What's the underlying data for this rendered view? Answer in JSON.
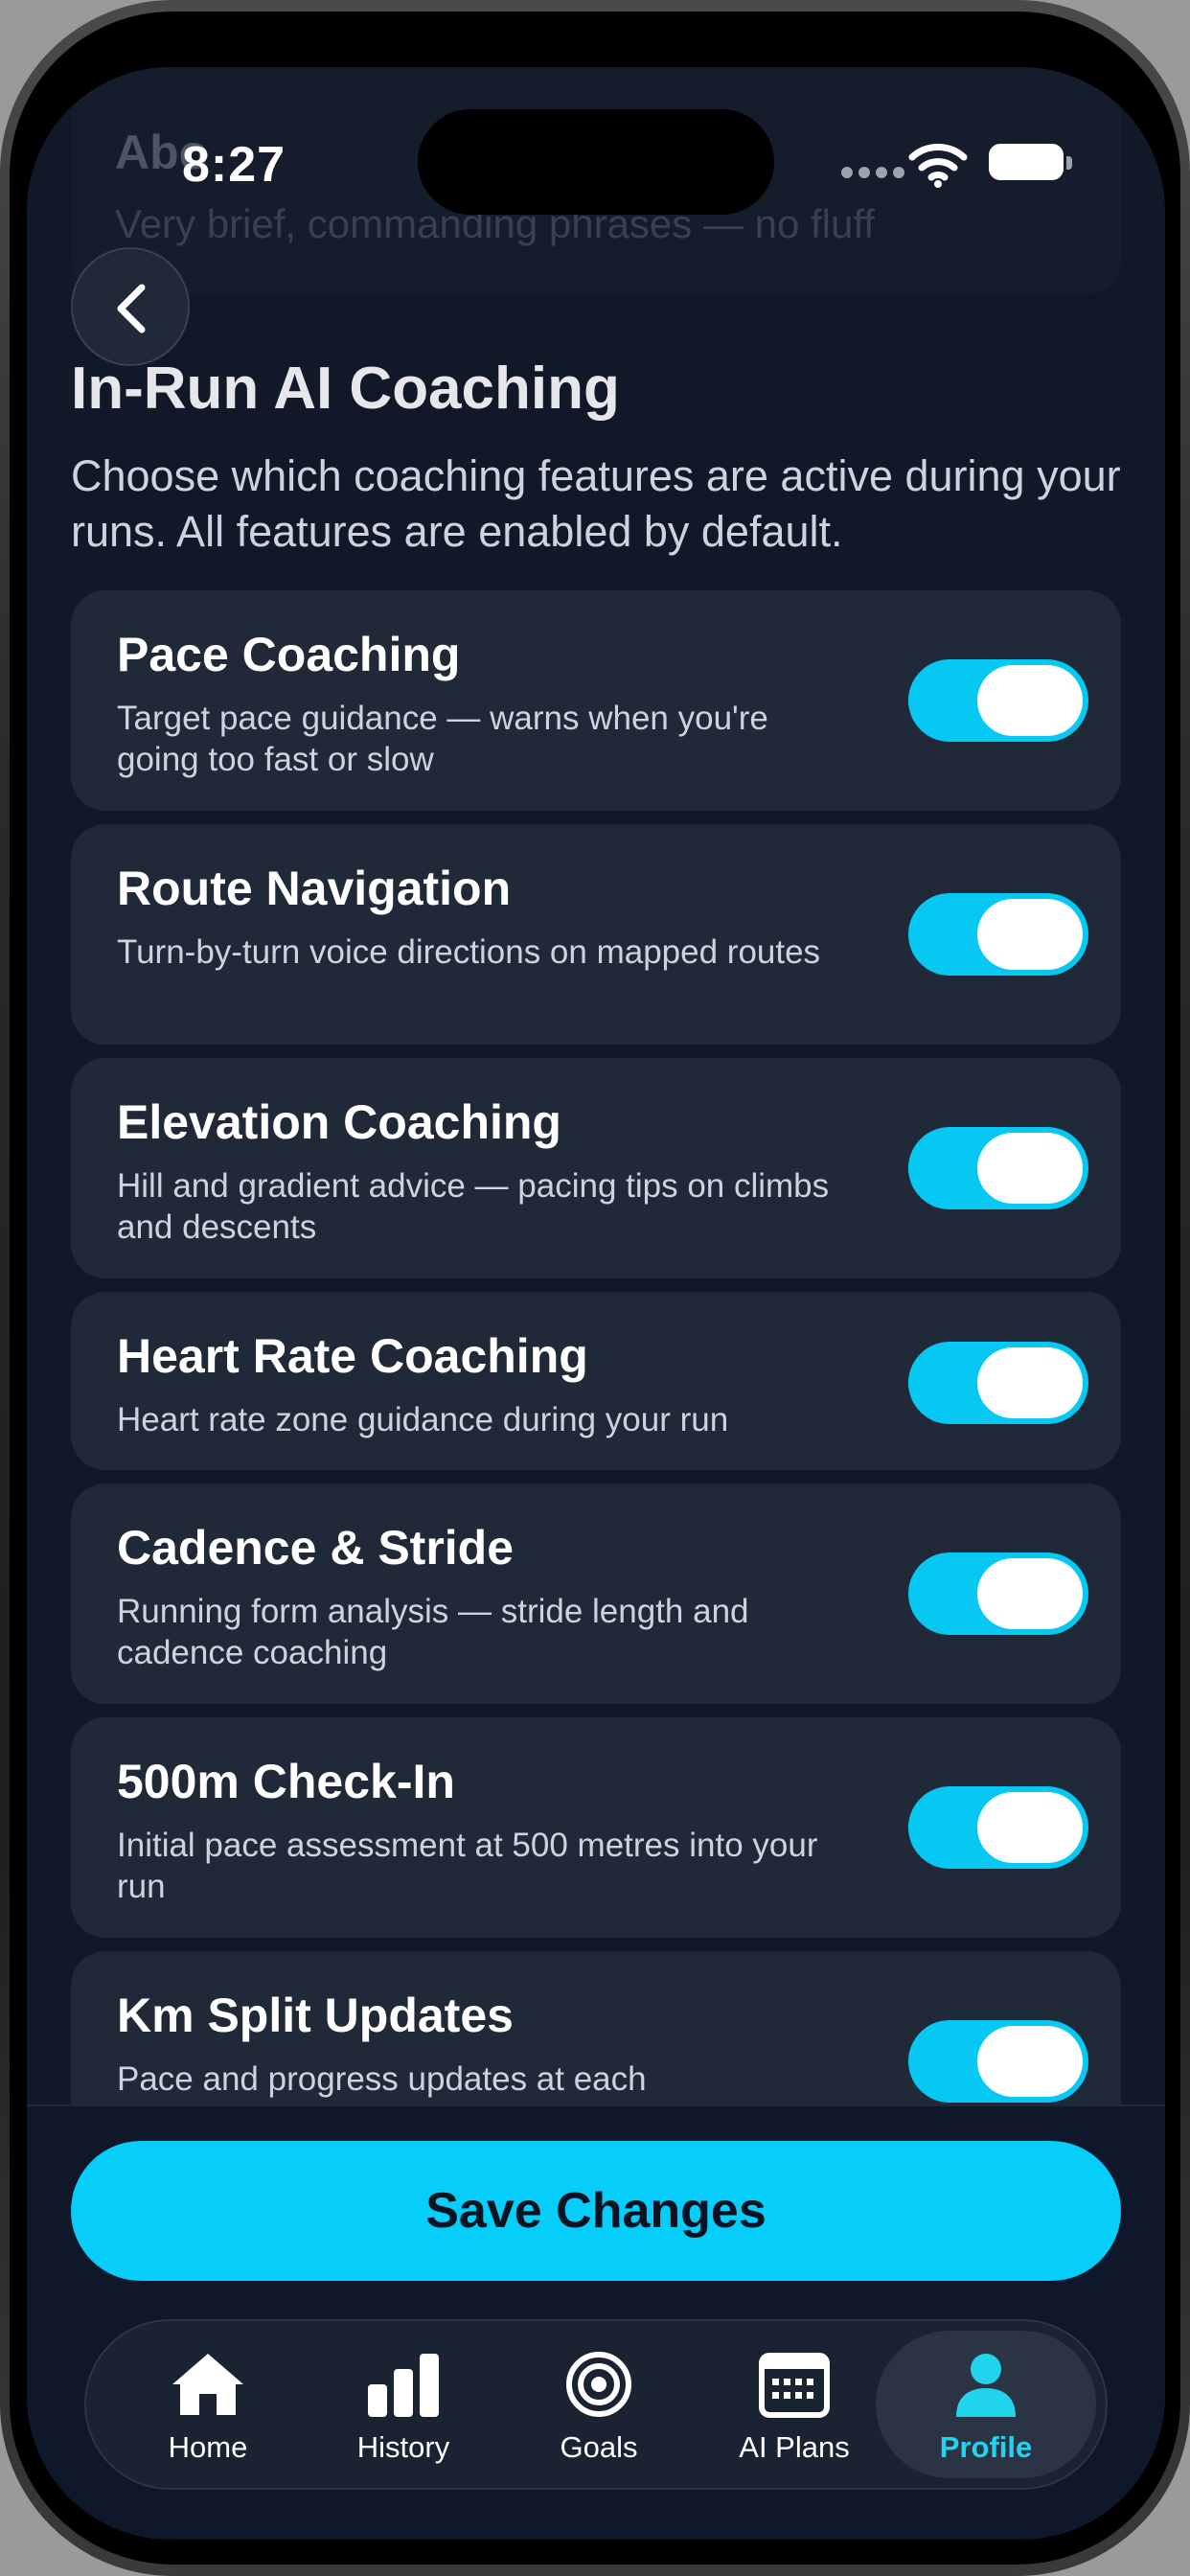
{
  "status_bar": {
    "time": "8:27"
  },
  "behind_header": {
    "title": "Abo",
    "subtitle": "Very brief, commanding phrases — no fluff"
  },
  "header": {
    "back_icon": "chevron-left-icon",
    "title": "In-Run AI Coaching",
    "description": "Choose which coaching features are active during your runs. All features are enabled by default."
  },
  "features": [
    {
      "title": "Pace Coaching",
      "description": "Target pace guidance — warns when you're going too fast or slow",
      "enabled": true
    },
    {
      "title": "Route Navigation",
      "description": "Turn-by-turn voice directions on mapped routes",
      "enabled": true
    },
    {
      "title": "Elevation Coaching",
      "description": "Hill and gradient advice — pacing tips on climbs and descents",
      "enabled": true
    },
    {
      "title": "Heart Rate Coaching",
      "description": "Heart rate zone guidance during your run",
      "enabled": true
    },
    {
      "title": "Cadence & Stride",
      "description": "Running form analysis — stride length and cadence coaching",
      "enabled": true
    },
    {
      "title": "500m Check-In",
      "description": "Initial pace assessment at 500 metres into your run",
      "enabled": true
    },
    {
      "title": "Km Split Updates",
      "description": "Pace and progress updates at each",
      "enabled": true
    }
  ],
  "footer": {
    "save_label": "Save Changes"
  },
  "tabs": [
    {
      "label": "Home",
      "icon": "home-icon",
      "active": false
    },
    {
      "label": "History",
      "icon": "bar-chart-icon",
      "active": false
    },
    {
      "label": "Goals",
      "icon": "target-icon",
      "active": false
    },
    {
      "label": "AI Plans",
      "icon": "calendar-icon",
      "active": false
    },
    {
      "label": "Profile",
      "icon": "user-icon",
      "active": true
    }
  ],
  "colors": {
    "accent": "#06cdf9",
    "background": "#111827",
    "card": "#1f2937",
    "active_tab_label": "#22d3ee"
  }
}
